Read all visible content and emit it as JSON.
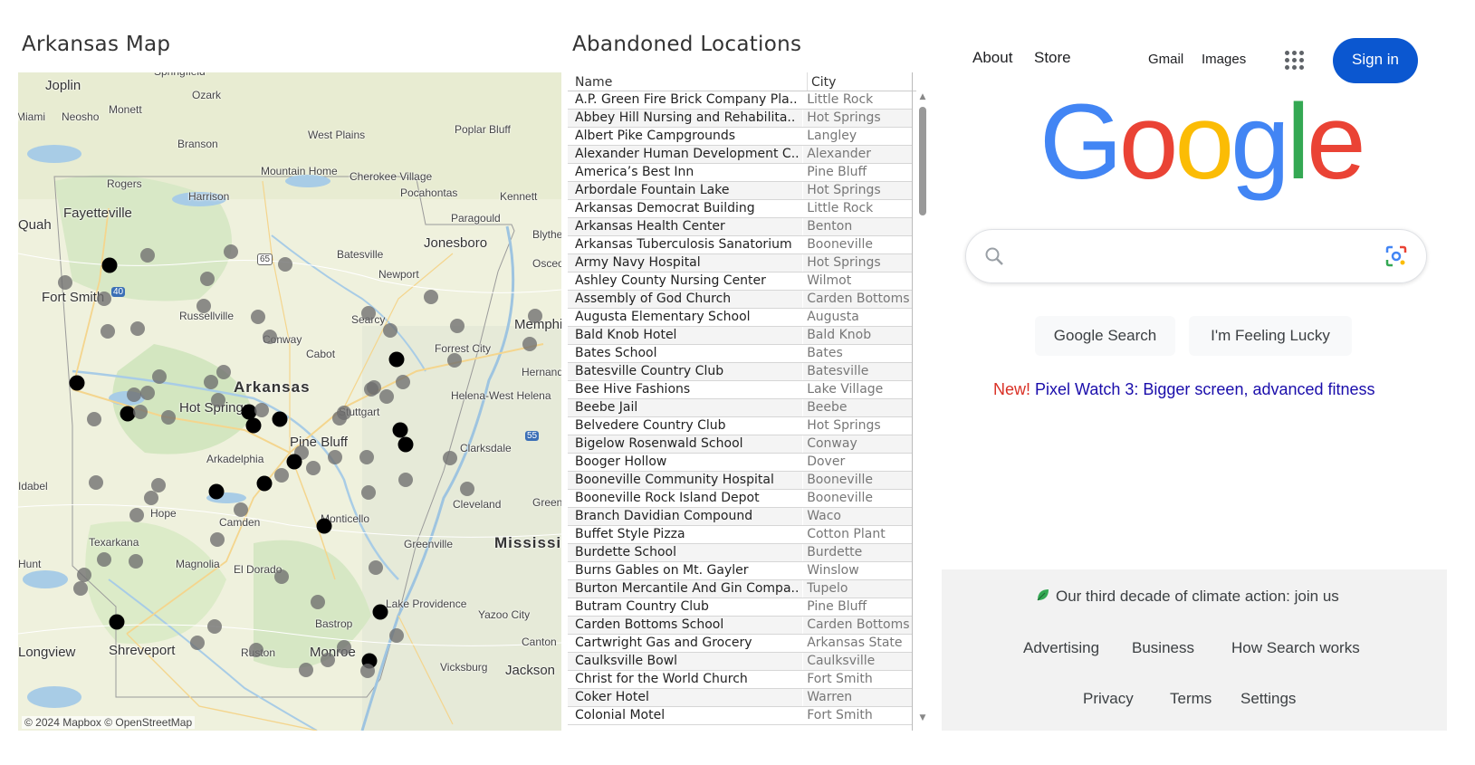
{
  "map": {
    "title": "Arkansas Map",
    "attribution": "© 2024 Mapbox © OpenStreetMap",
    "labels": [
      {
        "text": "Springfield",
        "cls": ""
      },
      {
        "text": "Joplin",
        "cls": "med"
      },
      {
        "text": "Ozark",
        "cls": ""
      },
      {
        "text": "Miami",
        "cls": ""
      },
      {
        "text": "Neosho",
        "cls": ""
      },
      {
        "text": "Monett",
        "cls": ""
      },
      {
        "text": "West Plains",
        "cls": ""
      },
      {
        "text": "Poplar Bluff",
        "cls": ""
      },
      {
        "text": "Branson",
        "cls": ""
      },
      {
        "text": "Mountain Home",
        "cls": ""
      },
      {
        "text": "Cherokee Village",
        "cls": ""
      },
      {
        "text": "Rogers",
        "cls": ""
      },
      {
        "text": "Harrison",
        "cls": ""
      },
      {
        "text": "Pocahontas",
        "cls": ""
      },
      {
        "text": "Kennett",
        "cls": ""
      },
      {
        "text": "Fayetteville",
        "cls": "med"
      },
      {
        "text": "Paragould",
        "cls": ""
      },
      {
        "text": "Blythe",
        "cls": ""
      },
      {
        "text": "Jonesboro",
        "cls": "med"
      },
      {
        "text": "Batesville",
        "cls": ""
      },
      {
        "text": "Osceola",
        "cls": ""
      },
      {
        "text": "Newport",
        "cls": ""
      },
      {
        "text": "Fort Smith",
        "cls": "med"
      },
      {
        "text": "Russellville",
        "cls": ""
      },
      {
        "text": "Searcy",
        "cls": ""
      },
      {
        "text": "Memphis",
        "cls": "med"
      },
      {
        "text": "Conway",
        "cls": ""
      },
      {
        "text": "Cabot",
        "cls": ""
      },
      {
        "text": "Forrest City",
        "cls": ""
      },
      {
        "text": "Hernando",
        "cls": ""
      },
      {
        "text": "Arkansas",
        "cls": "big"
      },
      {
        "text": "Helena-West Helena",
        "cls": ""
      },
      {
        "text": "Hot Springs",
        "cls": "med"
      },
      {
        "text": "Stuttgart",
        "cls": ""
      },
      {
        "text": "Pine Bluff",
        "cls": "med"
      },
      {
        "text": "Clarksdale",
        "cls": ""
      },
      {
        "text": "Arkadelphia",
        "cls": ""
      },
      {
        "text": "Idabel",
        "cls": ""
      },
      {
        "text": "Cleveland",
        "cls": ""
      },
      {
        "text": "Greenwood",
        "cls": ""
      },
      {
        "text": "Hope",
        "cls": ""
      },
      {
        "text": "Camden",
        "cls": ""
      },
      {
        "text": "Monticello",
        "cls": ""
      },
      {
        "text": "Texarkana",
        "cls": ""
      },
      {
        "text": "Greenville",
        "cls": ""
      },
      {
        "text": "Mississippi",
        "cls": "big"
      },
      {
        "text": "Magnolia",
        "cls": ""
      },
      {
        "text": "El Dorado",
        "cls": ""
      },
      {
        "text": "Hunt",
        "cls": ""
      },
      {
        "text": "Lake Providence",
        "cls": ""
      },
      {
        "text": "Yazoo City",
        "cls": ""
      },
      {
        "text": "Bastrop",
        "cls": ""
      },
      {
        "text": "Canton",
        "cls": ""
      },
      {
        "text": "Longview",
        "cls": "med"
      },
      {
        "text": "Shreveport",
        "cls": "med"
      },
      {
        "text": "Ruston",
        "cls": ""
      },
      {
        "text": "Monroe",
        "cls": "med"
      },
      {
        "text": "Vicksburg",
        "cls": ""
      },
      {
        "text": "Jackson",
        "cls": "med"
      },
      {
        "text": "Quah",
        "cls": "med"
      }
    ],
    "shields": [
      "65",
      "40",
      "55"
    ],
    "point_color_light": "#6e6e6e",
    "point_color_dark": "#000000"
  },
  "table": {
    "title": "Abandoned Locations",
    "col_name": "Name",
    "col_city": "City",
    "rows": [
      {
        "name": "A.P. Green Fire Brick Company Pla..",
        "city": "Little Rock"
      },
      {
        "name": "Abbey Hill Nursing and Rehabilita..",
        "city": "Hot Springs"
      },
      {
        "name": "Albert Pike Campgrounds",
        "city": "Langley"
      },
      {
        "name": "Alexander Human Development C..",
        "city": "Alexander"
      },
      {
        "name": "America’s Best Inn",
        "city": "Pine Bluff"
      },
      {
        "name": "Arbordale Fountain Lake",
        "city": "Hot Springs"
      },
      {
        "name": "Arkansas Democrat Building",
        "city": "Little Rock"
      },
      {
        "name": "Arkansas Health Center",
        "city": "Benton"
      },
      {
        "name": "Arkansas Tuberculosis Sanatorium",
        "city": "Booneville"
      },
      {
        "name": "Army Navy Hospital",
        "city": "Hot Springs"
      },
      {
        "name": "Ashley County Nursing Center",
        "city": "Wilmot"
      },
      {
        "name": "Assembly of God Church",
        "city": "Carden Bottoms"
      },
      {
        "name": "Augusta Elementary School",
        "city": "Augusta"
      },
      {
        "name": "Bald Knob Hotel",
        "city": "Bald Knob"
      },
      {
        "name": "Bates School",
        "city": "Bates"
      },
      {
        "name": "Batesville Country Club",
        "city": "Batesville"
      },
      {
        "name": "Bee Hive Fashions",
        "city": "Lake Village"
      },
      {
        "name": "Beebe Jail",
        "city": "Beebe"
      },
      {
        "name": "Belvedere Country Club",
        "city": "Hot Springs"
      },
      {
        "name": "Bigelow Rosenwald School",
        "city": "Conway"
      },
      {
        "name": "Booger Hollow",
        "city": "Dover"
      },
      {
        "name": "Booneville Community Hospital",
        "city": "Booneville"
      },
      {
        "name": "Booneville Rock Island Depot",
        "city": "Booneville"
      },
      {
        "name": "Branch Davidian Compound",
        "city": "Waco"
      },
      {
        "name": "Buffet Style Pizza",
        "city": "Cotton Plant"
      },
      {
        "name": "Burdette School",
        "city": "Burdette"
      },
      {
        "name": "Burns Gables on Mt. Gayler",
        "city": "Winslow"
      },
      {
        "name": "Burton Mercantile And Gin Compa..",
        "city": "Tupelo"
      },
      {
        "name": "Butram Country Club",
        "city": "Pine Bluff"
      },
      {
        "name": "Carden Bottoms School",
        "city": "Carden Bottoms"
      },
      {
        "name": "Cartwright Gas and Grocery",
        "city": "Arkansas State"
      },
      {
        "name": "Caulksville Bowl",
        "city": "Caulksville"
      },
      {
        "name": "Christ for the World Church",
        "city": "Fort Smith"
      },
      {
        "name": "Coker Hotel",
        "city": "Warren"
      },
      {
        "name": "Colonial Motel",
        "city": "Fort Smith"
      }
    ]
  },
  "google": {
    "nav_about": "About",
    "nav_store": "Store",
    "nav_gmail": "Gmail",
    "nav_images": "Images",
    "sign_in": "Sign in",
    "search_placeholder": "",
    "btn_search": "Google Search",
    "btn_lucky": "I'm Feeling Lucky",
    "promo_new": "New!",
    "promo_text": " Pixel Watch 3: Bigger screen, advanced fitness",
    "climate": "Our third decade of climate action: join us",
    "footer_advertising": "Advertising",
    "footer_business": "Business",
    "footer_how": "How Search works",
    "footer_privacy": "Privacy",
    "footer_terms": "Terms",
    "footer_settings": "Settings",
    "logo_colors": [
      "#4285F4",
      "#EA4335",
      "#FBBC05",
      "#4285F4",
      "#34A853",
      "#EA4335"
    ]
  }
}
